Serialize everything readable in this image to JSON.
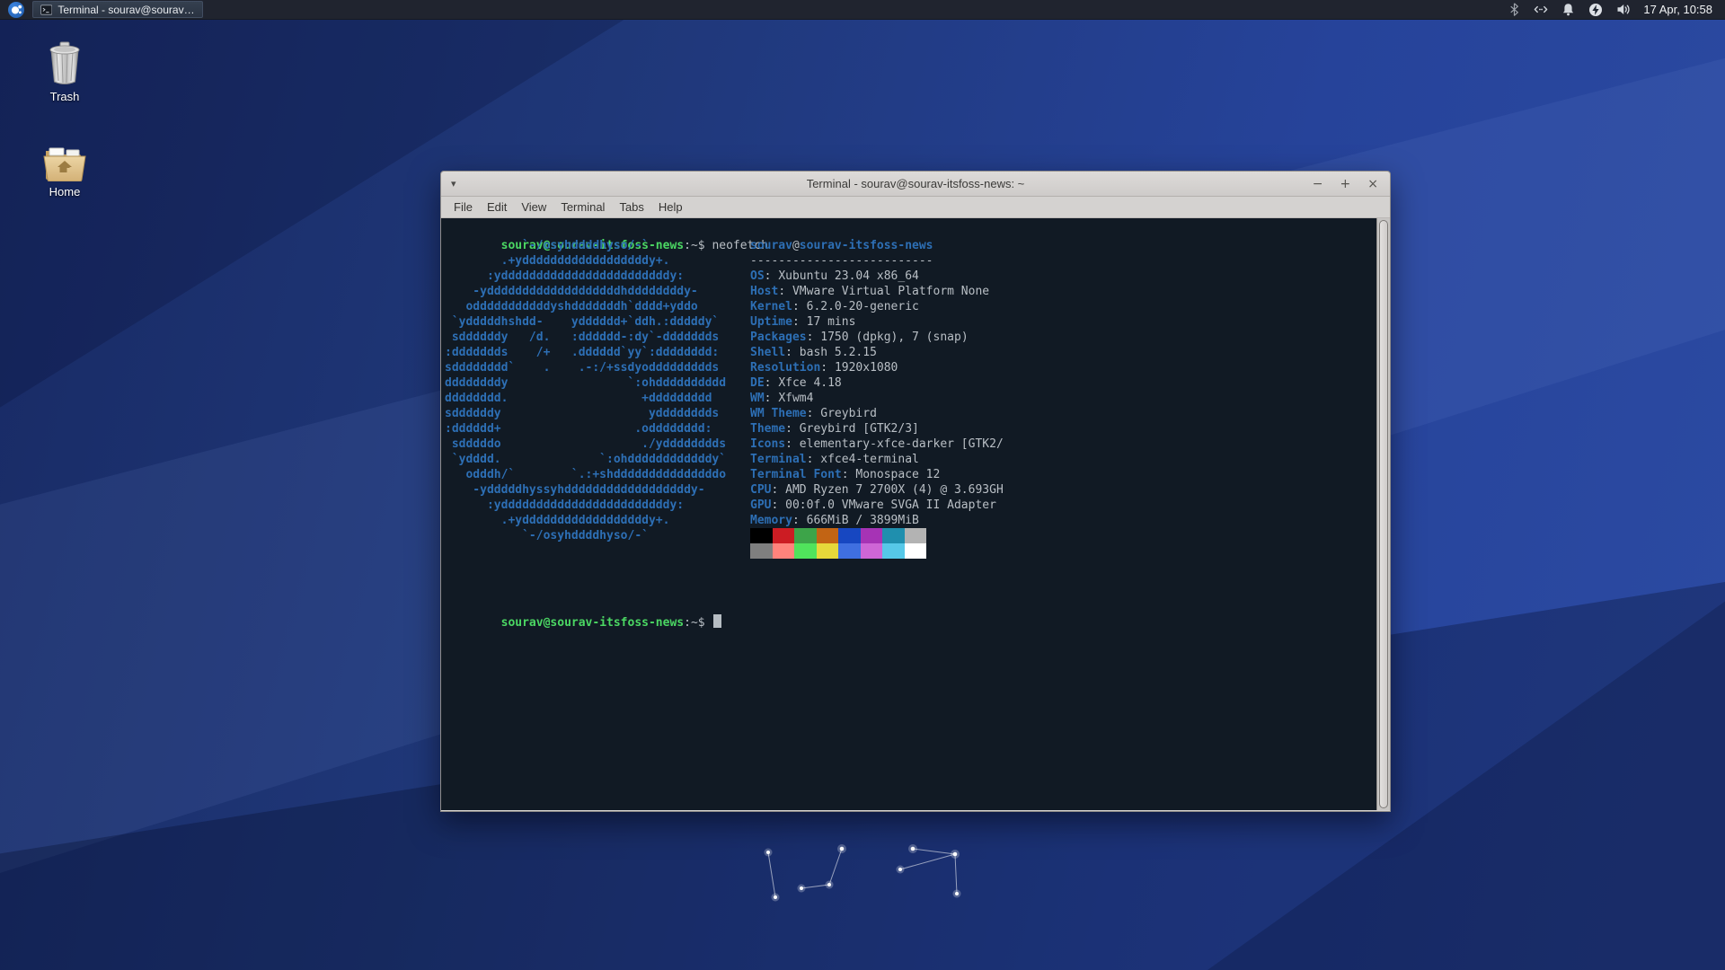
{
  "panel": {
    "taskbar": {
      "title": "Terminal - sourav@sourav-it..."
    },
    "clock": "17 Apr, 10:58"
  },
  "desktop": {
    "icons": [
      {
        "id": "trash",
        "label": "Trash"
      },
      {
        "id": "home",
        "label": "Home"
      }
    ]
  },
  "window": {
    "title": "Terminal - sourav@sourav-itsfoss-news: ~",
    "controls": {
      "minimize": "−",
      "maximize": "+",
      "close": "×"
    },
    "menu": [
      "File",
      "Edit",
      "View",
      "Terminal",
      "Tabs",
      "Help"
    ]
  },
  "terminal": {
    "prompt_user": "sourav@sourav-itsfoss-news",
    "prompt_tail": ":~$",
    "command": "neofetch",
    "header_user": "sourav",
    "header_at": "@",
    "header_host": "sourav-itsfoss-news",
    "separator": "--------------------------",
    "ascii_art": [
      "           `-/osyhddddhyso/-`",
      "        .+yddddddddddddddddddy+.",
      "      :yddddddddddddddddddddddddy:",
      "    -ydddddddddddddddddddhddddddddy-",
      "   odddddddddddyshdddddddh`dddd+yddo",
      " `ydddddhshdd-    ydddddd+`ddh.:dddddy`",
      " sddddddy   /d.   :dddddd-:dy`-ddddddds",
      ":ddddddds    /+   .dddddd`yy`:dddddddd:",
      "sdddddddd`    .    .-:/+ssdyoddddddddds",
      "ddddddddy                 `:ohdddddddddd",
      "dddddddd.                   +ddddddddd",
      "sddddddy                     ydddddddds",
      ":dddddd+                   .odddddddd:",
      " sdddddo                    ./ydddddddds",
      " `ydddd.              `:ohddddddddddddy`",
      "   odddh/`        `.:+shdddddddddddddddo",
      "    -ydddddhyssyhddddddddddddddddddy-",
      "      :yddddddddddddddddddddddddy:",
      "        .+yddddddddddddddddddy+.",
      "           `-/osyhddddhyso/-`"
    ],
    "info": [
      [
        "OS",
        "Xubuntu 23.04 x86_64"
      ],
      [
        "Host",
        "VMware Virtual Platform None"
      ],
      [
        "Kernel",
        "6.2.0-20-generic"
      ],
      [
        "Uptime",
        "17 mins"
      ],
      [
        "Packages",
        "1750 (dpkg), 7 (snap)"
      ],
      [
        "Shell",
        "bash 5.2.15"
      ],
      [
        "Resolution",
        "1920x1080"
      ],
      [
        "DE",
        "Xfce 4.18"
      ],
      [
        "WM",
        "Xfwm4"
      ],
      [
        "WM Theme",
        "Greybird"
      ],
      [
        "Theme",
        "Greybird [GTK2/3]"
      ],
      [
        "Icons",
        "elementary-xfce-darker [GTK2/"
      ],
      [
        "Terminal",
        "xfce4-terminal"
      ],
      [
        "Terminal Font",
        "Monospace 12"
      ],
      [
        "CPU",
        "AMD Ryzen 7 2700X (4) @ 3.693GH"
      ],
      [
        "GPU",
        "00:0f.0 VMware SVGA II Adapter"
      ],
      [
        "Memory",
        "666MiB / 3899MiB"
      ]
    ],
    "palette_row1": [
      "#000000",
      "#cc1c23",
      "#3da449",
      "#c26414",
      "#1747c1",
      "#a633b5",
      "#1f8fae",
      "#b3b3b3"
    ],
    "palette_row2": [
      "#7f7f7f",
      "#ff837c",
      "#50e35c",
      "#e6d83a",
      "#3f6fe0",
      "#ce66d6",
      "#56c8e8",
      "#ffffff"
    ],
    "colors": {
      "background": "#111a24",
      "foreground": "#b9bfc5",
      "blue": "#2d6fb5",
      "green": "#4bd763"
    }
  }
}
